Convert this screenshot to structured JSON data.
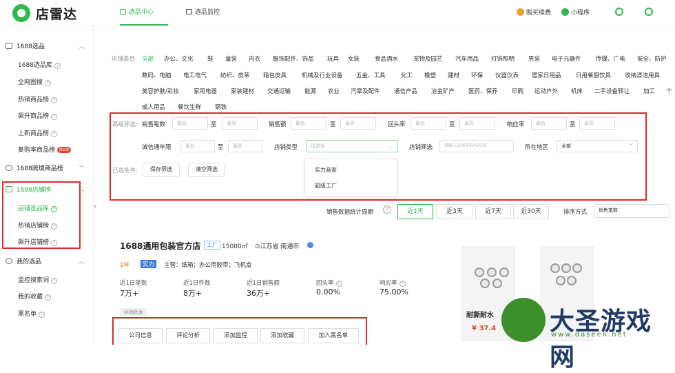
{
  "app": {
    "name": "店雷达"
  },
  "topnav": {
    "tabs": [
      {
        "label": "选品中心"
      },
      {
        "label": "选品监控"
      }
    ],
    "right": {
      "buy": "购买续费",
      "mini": "小程序"
    }
  },
  "sidebar": {
    "sections": [
      {
        "label": "1688选品",
        "items": [
          {
            "label": "1688选品库"
          },
          {
            "label": "全网图搜"
          },
          {
            "label": "热销商品榜"
          },
          {
            "label": "飙升商品榜"
          },
          {
            "label": "上新商品榜"
          },
          {
            "label": "复购率商品榜",
            "badge": "NEW"
          }
        ]
      },
      {
        "label": "1688跨境商品榜",
        "items": []
      },
      {
        "label": "1688店铺榜",
        "items": [
          {
            "label": "店铺选品库"
          },
          {
            "label": "热销店铺榜"
          },
          {
            "label": "飙升店铺榜"
          }
        ]
      },
      {
        "label": "我的选品",
        "items": [
          {
            "label": "监控搜索词"
          },
          {
            "label": "我的收藏"
          },
          {
            "label": "黑名单"
          }
        ]
      }
    ]
  },
  "filters": {
    "category_label": "店铺类目:",
    "categories": {
      "row1": [
        "全部",
        "办公、文化",
        "鞋",
        "童装",
        "内衣",
        "服饰配件、饰品",
        "玩具",
        "女装",
        "食品酒水",
        "宠物及园艺",
        "汽车用品",
        "灯饰照明",
        "男装",
        "电子元器件",
        "传媒、广电",
        "安全、防护"
      ],
      "row2": [
        "数码、电脑",
        "电工电气",
        "纺织、皮革",
        "箱包皮具",
        "机械及行业设备",
        "五金、工具",
        "化工",
        "橡塑",
        "建材",
        "环保",
        "仪器仪表",
        "居家日用品",
        "日用餐厨饮具",
        "收纳清洁用具"
      ],
      "row3": [
        "美容护肤/彩妆",
        "家用电器",
        "家装建材",
        "交通运输",
        "能源",
        "农业",
        "汽摩及配件",
        "通信产品",
        "冶金矿产",
        "医药、保养",
        "印刷",
        "运动户外",
        "机床",
        "二手设备转让",
        "加工",
        "个"
      ],
      "row4": [
        "成人用品",
        "餐饮生鲜",
        "钢铁"
      ]
    },
    "advanced_label": "高级筛选:",
    "to": "至",
    "min_ph": "最低",
    "max_ph": "最高",
    "sales_count": "销售笔数",
    "sales_amount": "销售额",
    "return_rate": "回头率",
    "response_rate": "响应率",
    "credit_years": "诚信通年限",
    "shop_type": "店铺类型",
    "shop_type_ph": "请选择",
    "shop_filter": "店铺筛选",
    "shop_filter_ph": "请输入店铺名称/旺旺名",
    "region": "所在地区",
    "region_value": "全部",
    "selected_label": "已选条件:",
    "save": "保存筛选",
    "clear": "清空筛选",
    "dropdown_options": [
      "实力商家",
      "超级工厂"
    ]
  },
  "period": {
    "label": "销售数据统计周期",
    "options": [
      "近1天",
      "近3天",
      "近7天",
      "近30天"
    ],
    "active": "近1天",
    "sort_label": "排序方式",
    "sort_value": "销售笔数"
  },
  "shop": {
    "name": "1688通用包装官方店",
    "tag": "工厂",
    "area": "15000㎡",
    "location": "江苏省 南通市",
    "years": "1年",
    "badge": "实力",
    "main": "主营：纸箱；办公用胶带；飞机盒",
    "chip": "经销批发",
    "stats": [
      {
        "label": "近1日笔数",
        "value": "7万+"
      },
      {
        "label": "近1日件数",
        "value": "8万+"
      },
      {
        "label": "近1日销售额",
        "value": "36万+"
      },
      {
        "label": "回头率",
        "value": "0.00%"
      },
      {
        "label": "响应率",
        "value": "75.00%"
      }
    ],
    "actions": [
      "公司信息",
      "评论分析",
      "添加监控",
      "添加收藏",
      "加入黑名单"
    ],
    "product_caption": "耐撕耐水",
    "product_price": "¥ 37.4"
  },
  "watermark": {
    "text": "大圣游戏网",
    "url": "www.daseen.net"
  },
  "colors": {
    "accent": "#2eb84d",
    "highlight": "#d62d2d"
  }
}
